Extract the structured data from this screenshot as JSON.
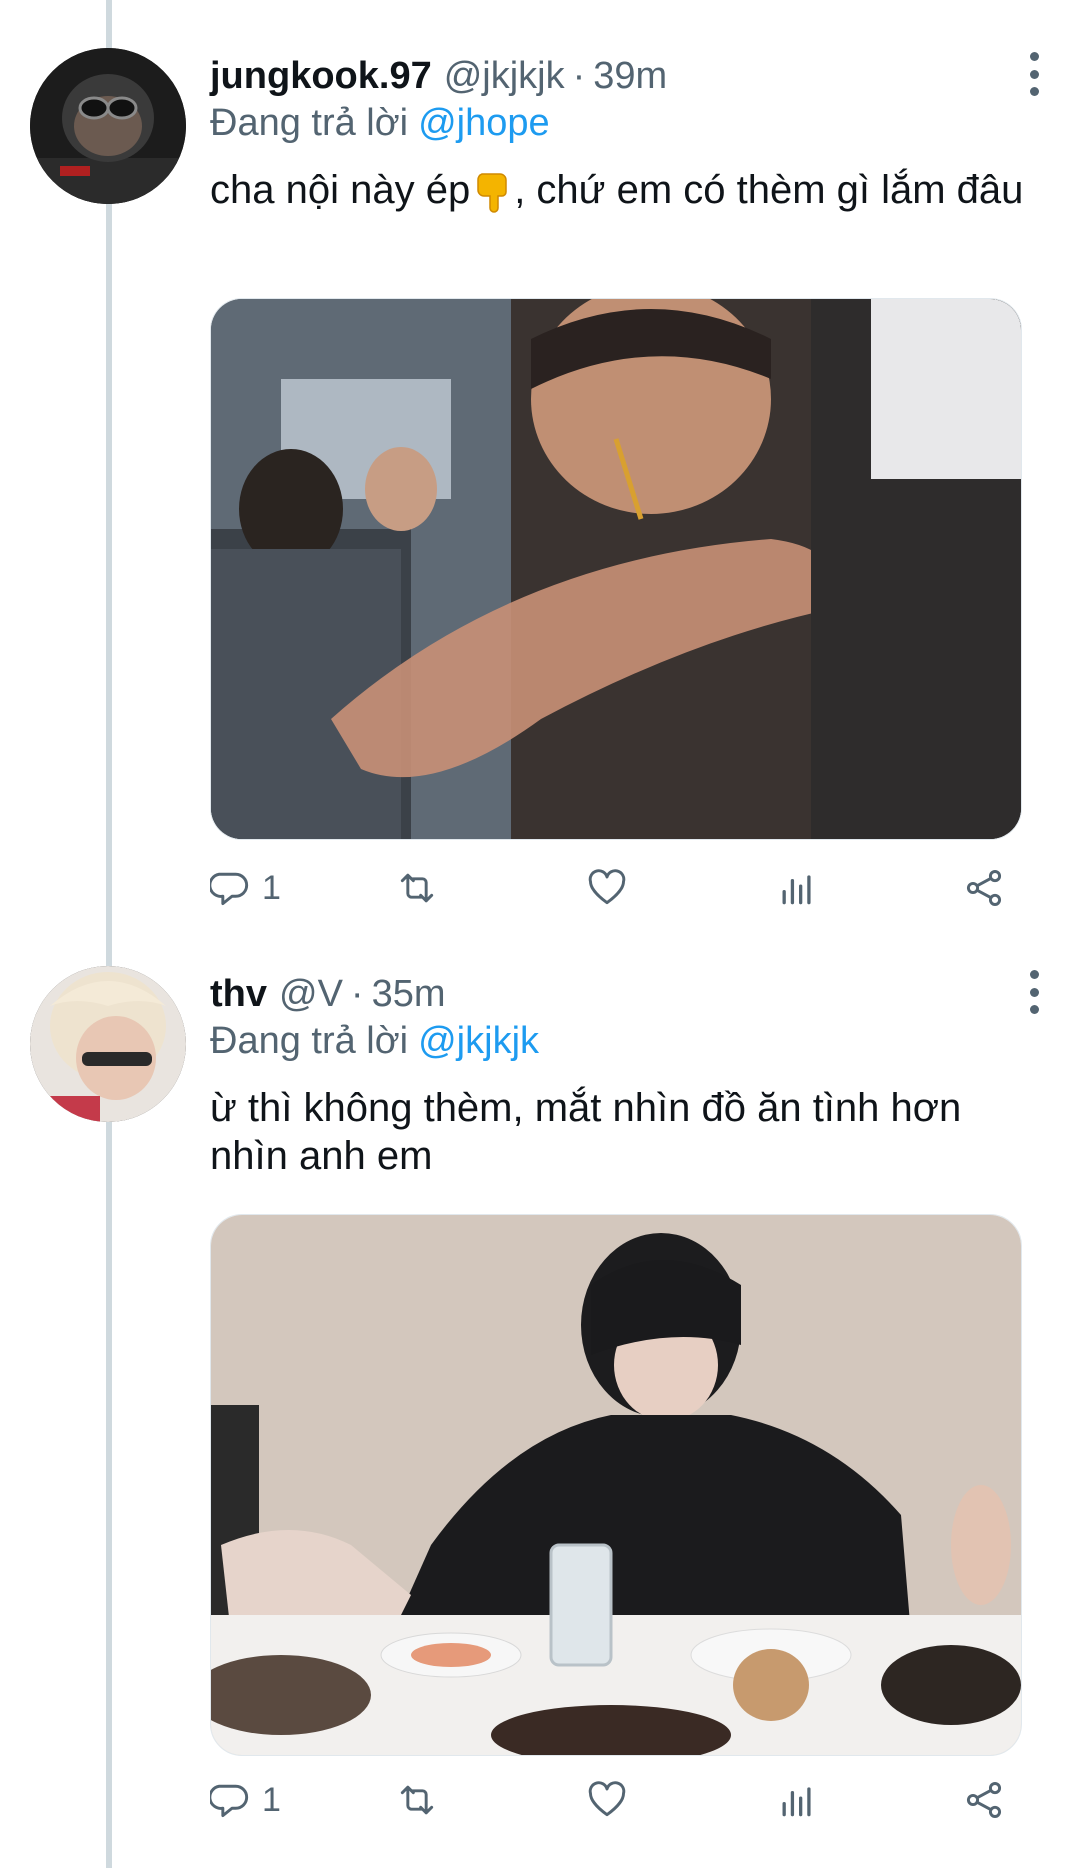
{
  "tweets": [
    {
      "name": "jungkook.97",
      "handle": "@jkjkjk",
      "separator": "·",
      "time": "39m",
      "reply_prefix": "Đang trả lời",
      "reply_to": "@jhope",
      "text_before_emoji": "cha nội này ép",
      "emoji": "backhand-index-pointing-down",
      "text_after_emoji": ", chứ em có thèm gì lắm đâu",
      "reply_count": "1",
      "avatar_icon": "helmet-avatar",
      "media_description_icon": "photo"
    },
    {
      "name": "thv",
      "handle": "@V",
      "separator": "·",
      "time": "35m",
      "reply_prefix": "Đang trả lời",
      "reply_to": "@jkjkjk",
      "text": "ừ thì không thèm, mắt nhìn đồ ăn tình hơn nhìn anh em",
      "reply_count": "1",
      "avatar_icon": "blonde-avatar",
      "media_description_icon": "photo"
    }
  ],
  "icons": {
    "reply": "reply-icon",
    "retweet": "retweet-icon",
    "like": "heart-icon",
    "views": "views-icon",
    "share": "share-icon",
    "more": "more-vertical-icon"
  },
  "colors": {
    "accent": "#1d9bf0",
    "secondary_text": "#536471",
    "primary_text": "#0f1419",
    "thread_line": "#cfd9de"
  }
}
